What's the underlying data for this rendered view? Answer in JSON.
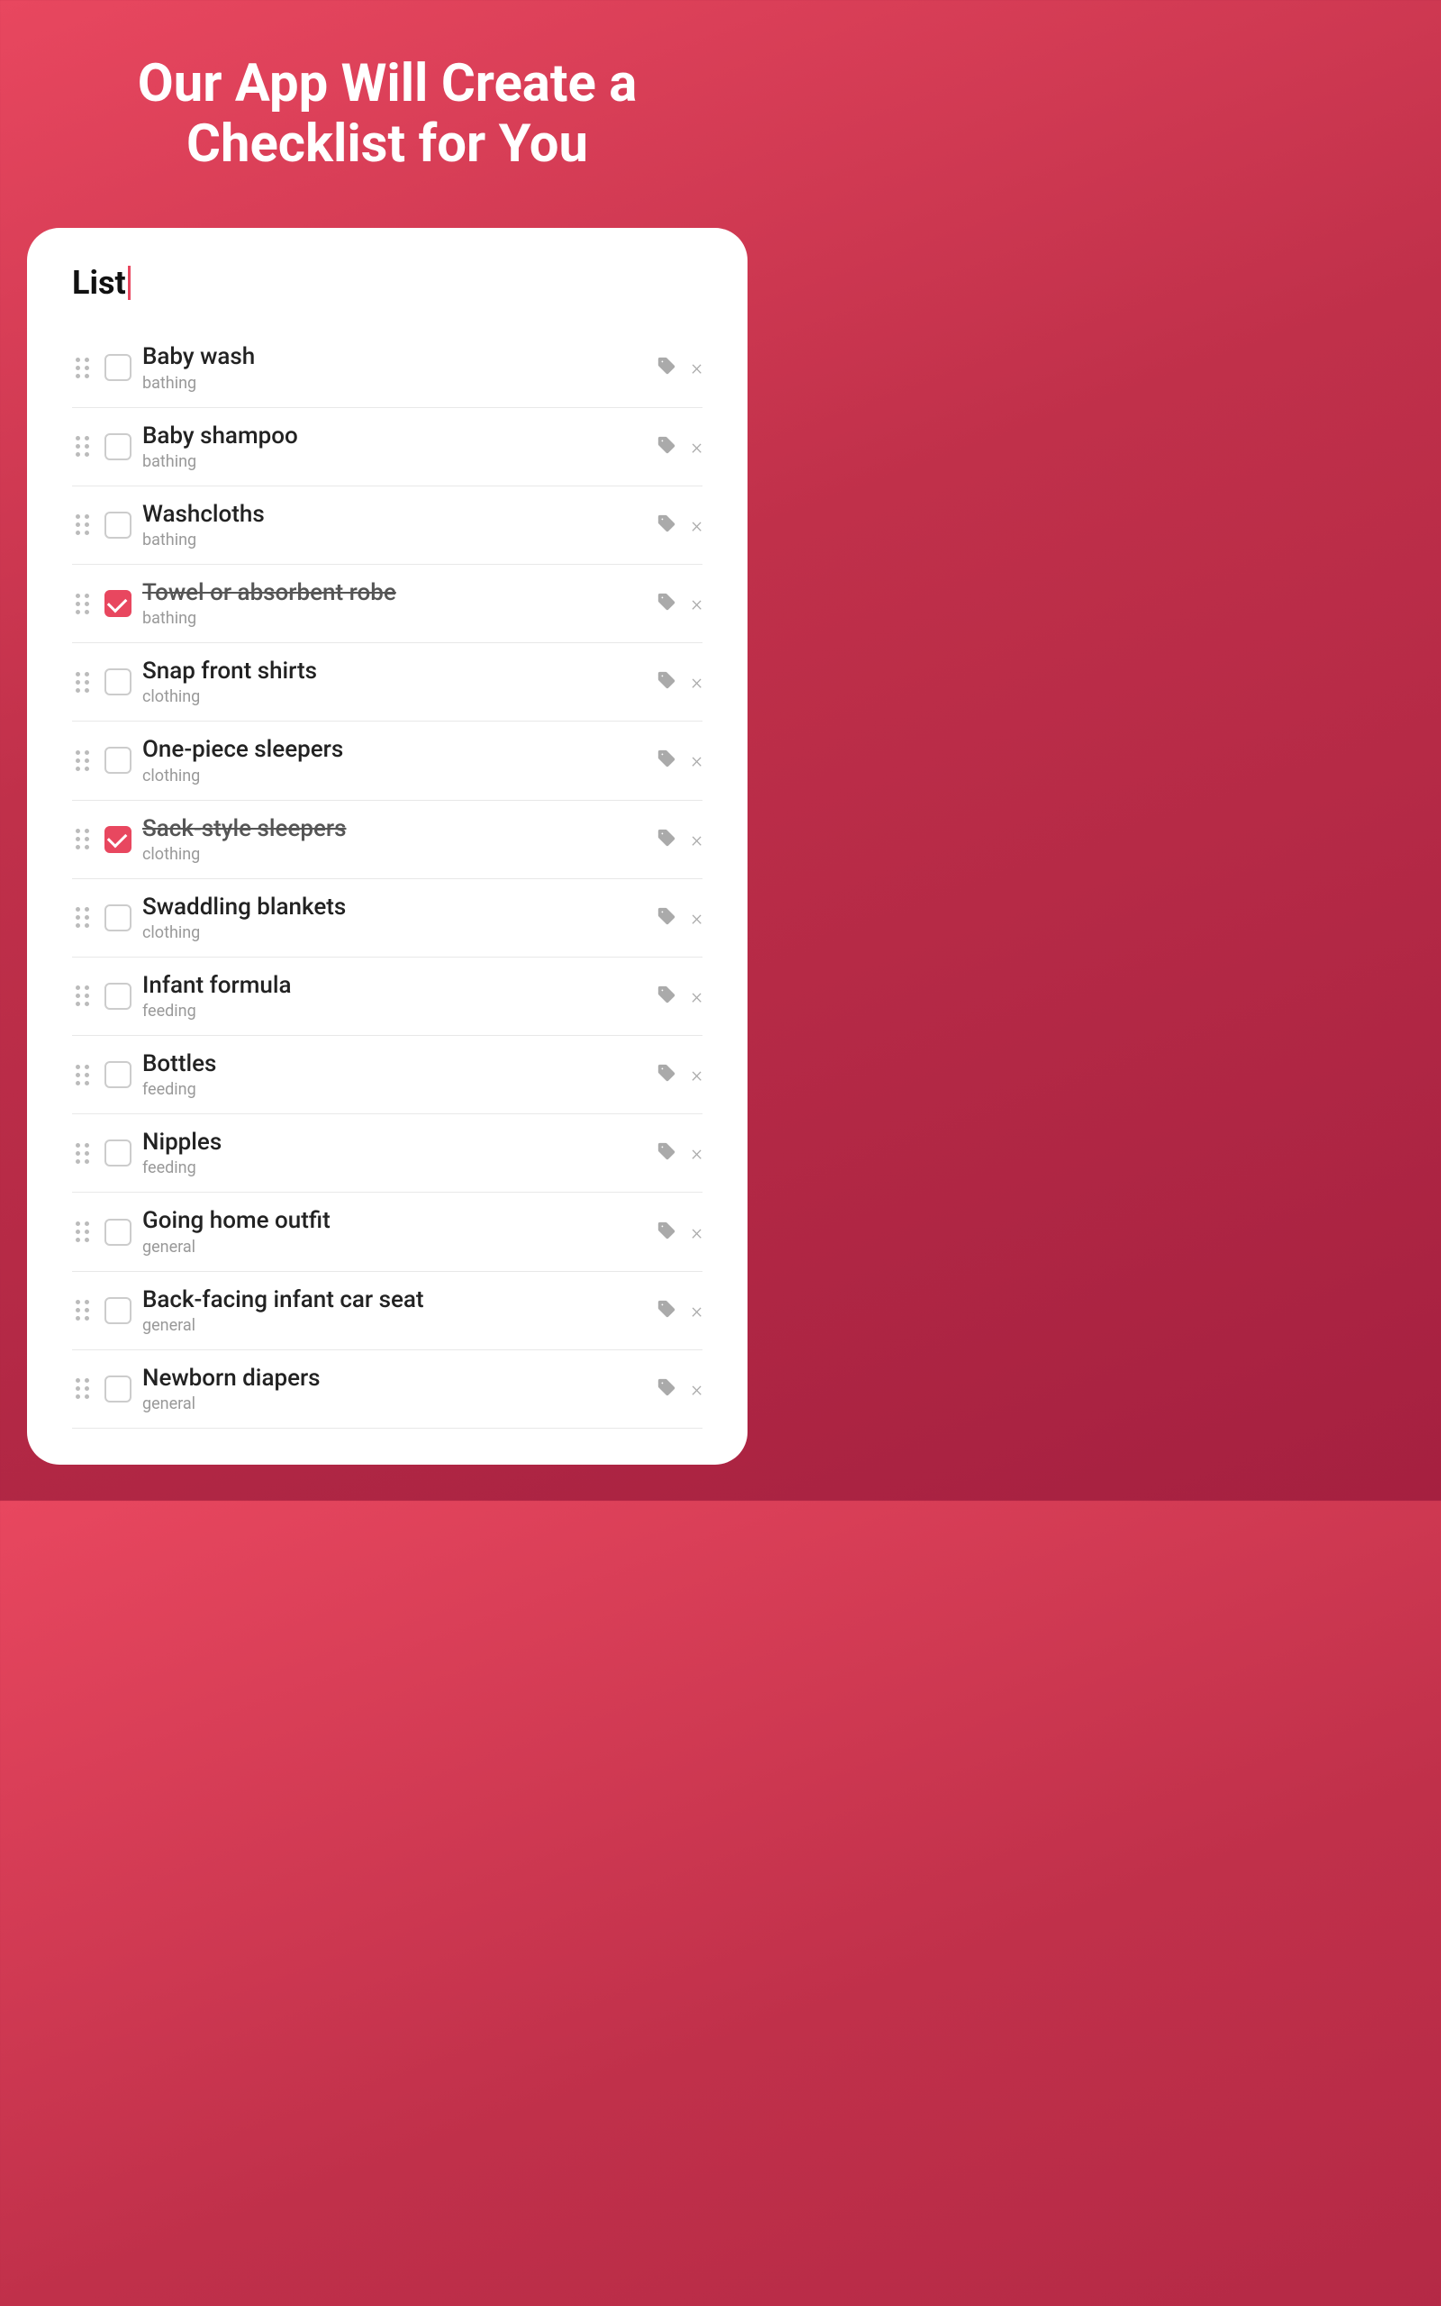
{
  "header": {
    "title": "Our App Will Create a Checklist for You"
  },
  "list": {
    "title": "List",
    "items": [
      {
        "id": 1,
        "name": "Baby wash",
        "category": "bathing",
        "checked": false
      },
      {
        "id": 2,
        "name": "Baby shampoo",
        "category": "bathing",
        "checked": false
      },
      {
        "id": 3,
        "name": "Washcloths",
        "category": "bathing",
        "checked": false
      },
      {
        "id": 4,
        "name": "Towel or absorbent robe",
        "category": "bathing",
        "checked": true
      },
      {
        "id": 5,
        "name": "Snap front shirts",
        "category": "clothing",
        "checked": false
      },
      {
        "id": 6,
        "name": "One-piece sleepers",
        "category": "clothing",
        "checked": false
      },
      {
        "id": 7,
        "name": "Sack-style sleepers",
        "category": "clothing",
        "checked": true
      },
      {
        "id": 8,
        "name": "Swaddling blankets",
        "category": "clothing",
        "checked": false
      },
      {
        "id": 9,
        "name": "Infant formula",
        "category": "feeding",
        "checked": false
      },
      {
        "id": 10,
        "name": "Bottles",
        "category": "feeding",
        "checked": false
      },
      {
        "id": 11,
        "name": "Nipples",
        "category": "feeding",
        "checked": false
      },
      {
        "id": 12,
        "name": "Going home outfit",
        "category": "general",
        "checked": false
      },
      {
        "id": 13,
        "name": "Back-facing infant car seat",
        "category": "general",
        "checked": false
      },
      {
        "id": 14,
        "name": "Newborn diapers",
        "category": "general",
        "checked": false
      }
    ]
  },
  "icons": {
    "tag": "tag-icon",
    "close": "×",
    "drag": "drag-handle"
  }
}
